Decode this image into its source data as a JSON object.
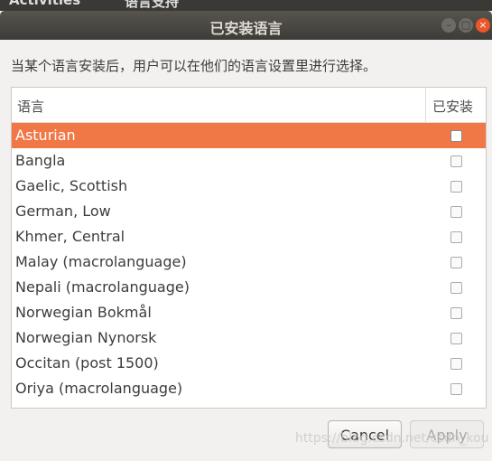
{
  "topbar": {
    "activities": "Activities",
    "app": "语言支持"
  },
  "window": {
    "title": "已安装语言"
  },
  "instruction": "当某个语言安装后，用户可以在他们的语言设置里进行选择。",
  "list": {
    "columns": [
      "语言",
      "已安装"
    ],
    "rows": [
      {
        "name": "Asturian",
        "installed": false,
        "selected": true
      },
      {
        "name": "Bangla",
        "installed": false
      },
      {
        "name": "Gaelic, Scottish",
        "installed": false
      },
      {
        "name": "German, Low",
        "installed": false
      },
      {
        "name": "Khmer, Central",
        "installed": false
      },
      {
        "name": "Malay (macrolanguage)",
        "installed": false
      },
      {
        "name": "Nepali (macrolanguage)",
        "installed": false
      },
      {
        "name": "Norwegian Bokmål",
        "installed": false
      },
      {
        "name": "Norwegian Nynorsk",
        "installed": false
      },
      {
        "name": "Occitan (post 1500)",
        "installed": false
      },
      {
        "name": "Oriya (macrolanguage)",
        "installed": false
      }
    ]
  },
  "buttons": {
    "cancel": "Cancel",
    "apply": "Apply"
  },
  "watermark": "https://blog.csdn.net/csdn_kou",
  "colors": {
    "selection": "#f07746",
    "close": "#e9572a"
  }
}
